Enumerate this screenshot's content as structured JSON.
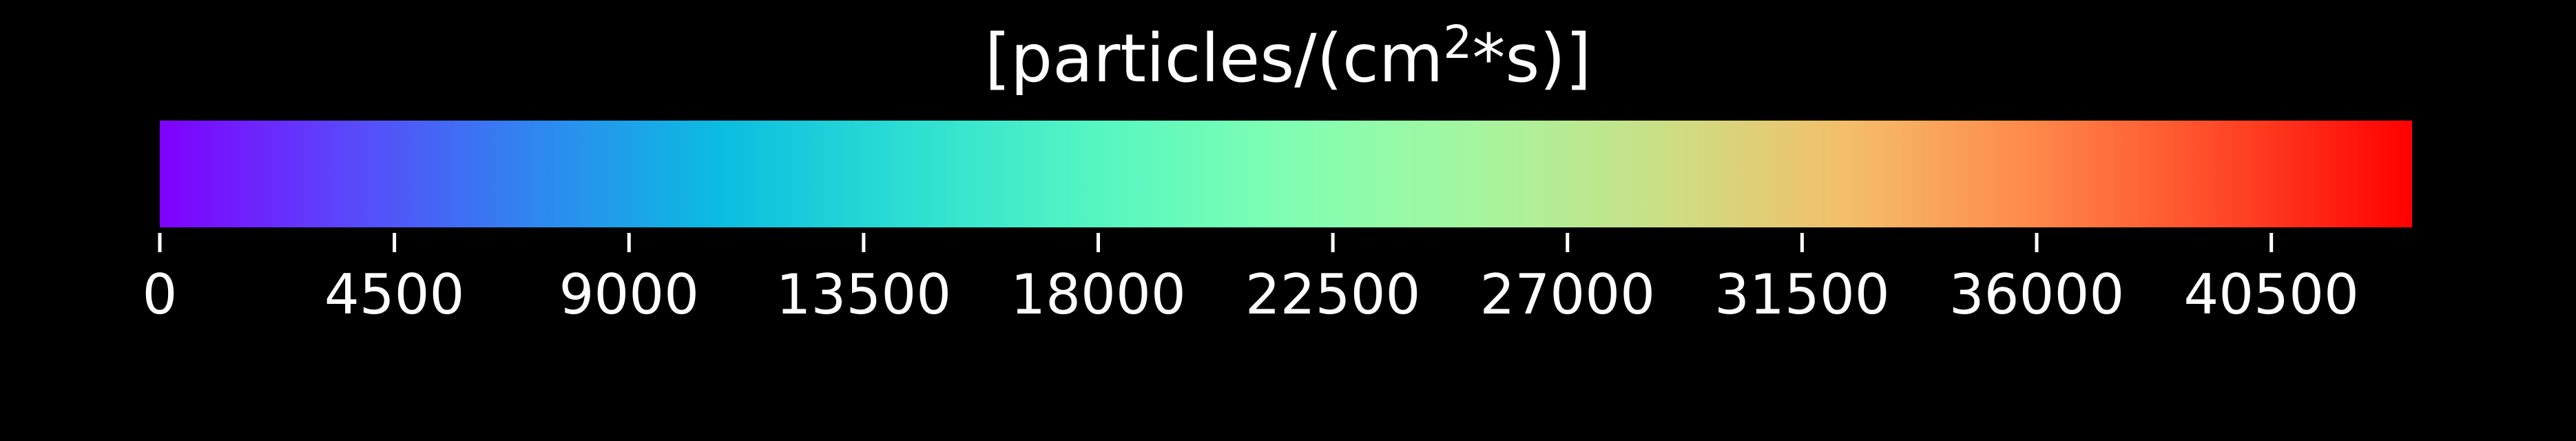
{
  "chart_data": {
    "type": "colorbar",
    "title_parts": [
      "[particles/(cm",
      "2",
      "*s)]"
    ],
    "vmin": 0,
    "vmax": 43200,
    "ticks": [
      0,
      4500,
      9000,
      13500,
      18000,
      22500,
      27000,
      31500,
      36000,
      40500
    ],
    "tick_labels": [
      "0",
      "4500",
      "9000",
      "13500",
      "18000",
      "22500",
      "27000",
      "31500",
      "36000",
      "40500"
    ],
    "colormap": "rainbow",
    "colormap_stops": [
      "#8000ff",
      "#5a48fb",
      "#2f87f0",
      "#0bbde1",
      "#2ddfd2",
      "#56f6c1",
      "#80feb3",
      "#a4f69f",
      "#cbdf85",
      "#f4be69",
      "#ff874a",
      "#ff4827",
      "#ff0000"
    ],
    "background_color": "#000000",
    "text_color": "#ffffff"
  }
}
